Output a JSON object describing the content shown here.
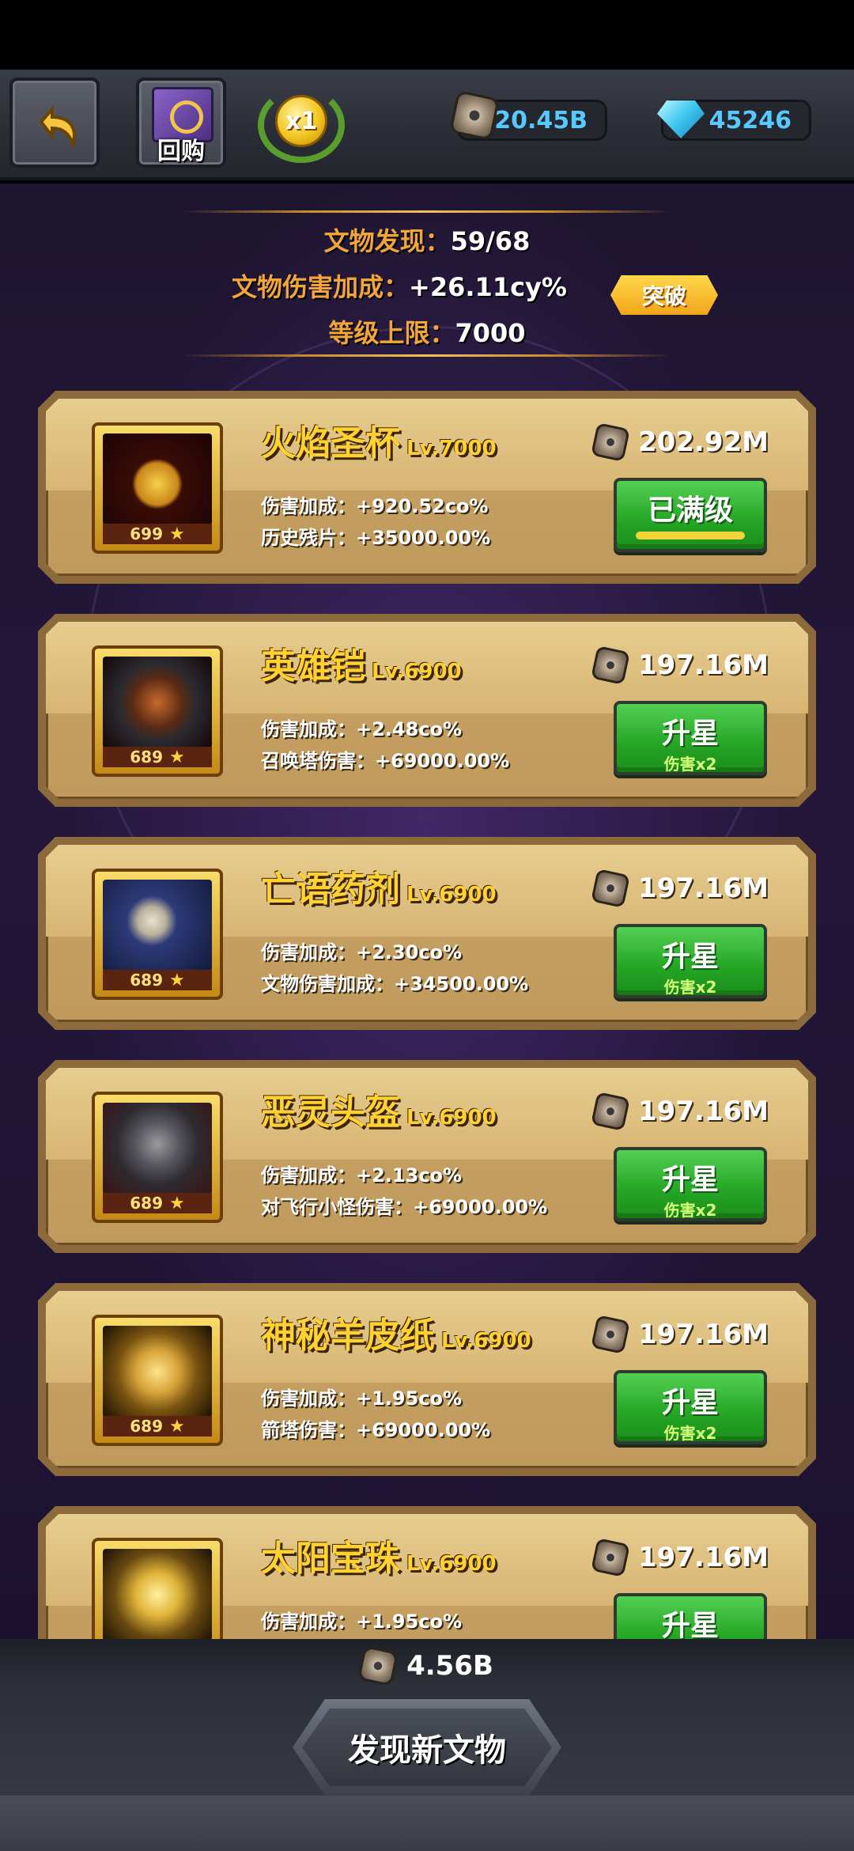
{
  "topbar": {
    "buyback_label": "回购",
    "speed_label": "x1",
    "gold": "20.45B",
    "gems": "45246"
  },
  "summary": {
    "discovered_label": "文物发现：",
    "discovered_value": "59/68",
    "damage_label": "文物伤害加成：",
    "damage_value": "+26.11cy%",
    "cap_label": "等级上限：",
    "cap_value": "7000",
    "breakthrough_label": "突破"
  },
  "artifacts": [
    {
      "name": "火焰圣杯",
      "level": "Lv.7000",
      "stars": "699",
      "cost": "202.92M",
      "stat1": "伤害加成：+920.52co%",
      "stat2": "历史残片：+35000.00%",
      "button_label": "已满级",
      "button_sub": ""
    },
    {
      "name": "英雄铠",
      "level": "Lv.6900",
      "stars": "689",
      "cost": "197.16M",
      "stat1": "伤害加成：+2.48co%",
      "stat2": "召唤塔伤害：+69000.00%",
      "button_label": "升星",
      "button_sub": "伤害x2"
    },
    {
      "name": "亡语药剂",
      "level": "Lv.6900",
      "stars": "689",
      "cost": "197.16M",
      "stat1": "伤害加成：+2.30co%",
      "stat2": "文物伤害加成：+34500.00%",
      "button_label": "升星",
      "button_sub": "伤害x2"
    },
    {
      "name": "恶灵头盔",
      "level": "Lv.6900",
      "stars": "689",
      "cost": "197.16M",
      "stat1": "伤害加成：+2.13co%",
      "stat2": "对飞行小怪伤害：+69000.00%",
      "button_label": "升星",
      "button_sub": "伤害x2"
    },
    {
      "name": "神秘羊皮纸",
      "level": "Lv.6900",
      "stars": "689",
      "cost": "197.16M",
      "stat1": "伤害加成：+1.95co%",
      "stat2": "箭塔伤害：+69000.00%",
      "button_label": "升星",
      "button_sub": "伤害x2"
    },
    {
      "name": "太阳宝珠",
      "level": "Lv.6900",
      "cost": "197.16M",
      "stat1": "伤害加成：+1.95co%",
      "button_label": "升星"
    }
  ],
  "bottom": {
    "cost": "4.56B",
    "discover_label": "发现新文物"
  },
  "colors": {
    "name_gold": "#ffd231",
    "label_orange": "#f2a63a",
    "resource_blue": "#58c9ff",
    "button_green": "#24a524"
  }
}
